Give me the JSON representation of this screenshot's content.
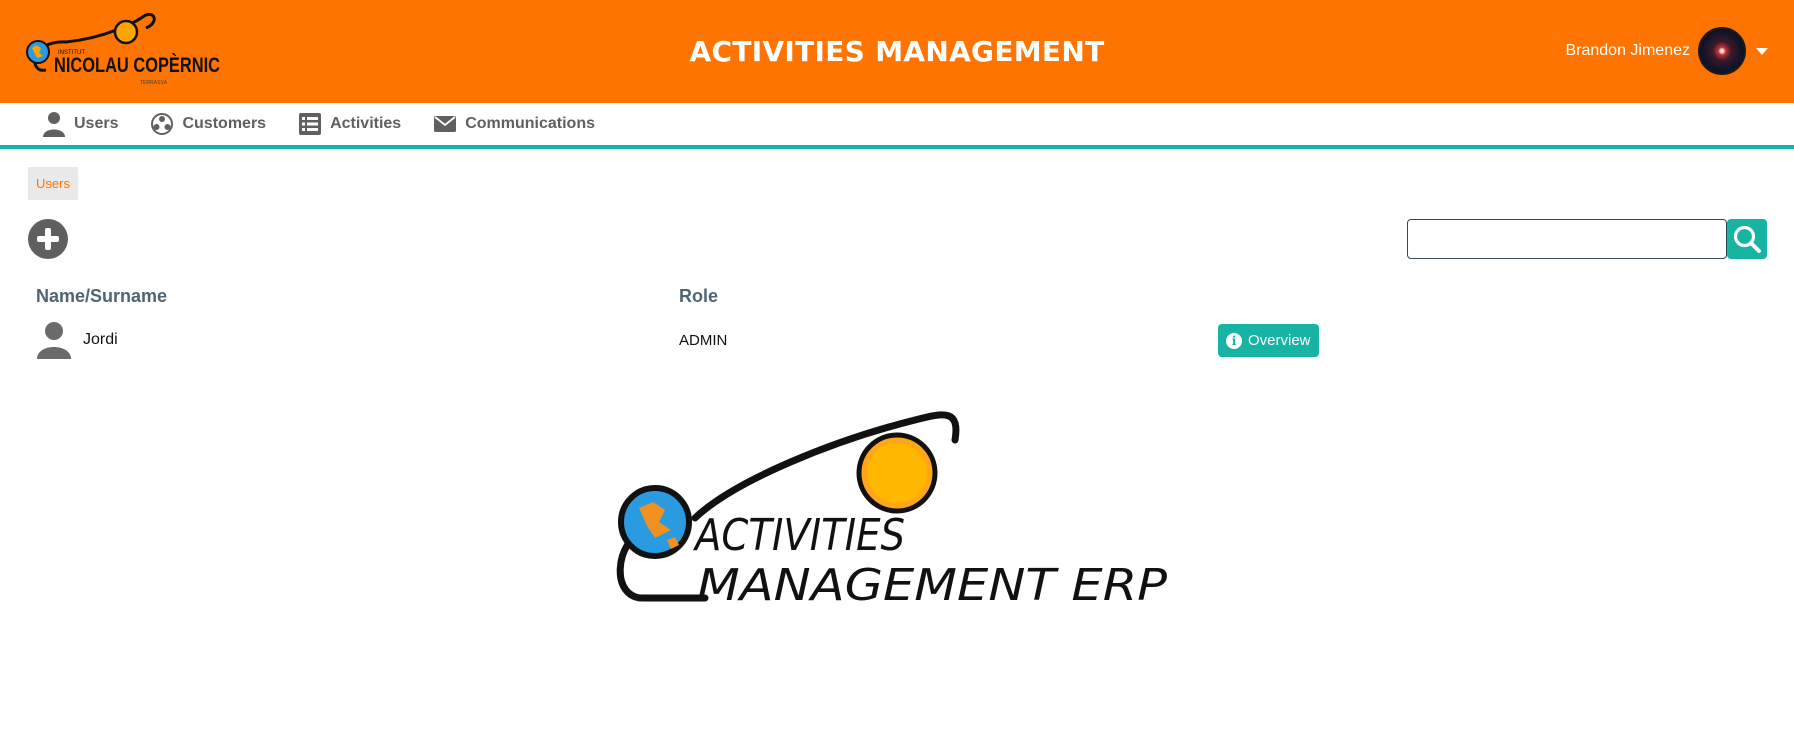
{
  "header": {
    "title": "ACTIVITIES MANAGEMENT",
    "logo": {
      "line1": "INSTITUT",
      "line2": "NICOLAU COPÈRNIC",
      "line3": "TERRASSA"
    },
    "user_name": "Brandon Jimenez",
    "background_color": "#ff7300"
  },
  "nav": {
    "items": [
      {
        "label": "Users",
        "icon": "user-icon"
      },
      {
        "label": "Customers",
        "icon": "customers-icon"
      },
      {
        "label": "Activities",
        "icon": "list-icon"
      },
      {
        "label": "Communications",
        "icon": "envelope-icon"
      }
    ],
    "accent_color": "#17b3a3"
  },
  "breadcrumb": {
    "current": "Users"
  },
  "search": {
    "value": "",
    "placeholder": ""
  },
  "table": {
    "columns": [
      "Name/Surname",
      "Role"
    ],
    "rows": [
      {
        "name": "Jordi",
        "role": "ADMIN",
        "action": "Overview"
      }
    ]
  },
  "footer_logo": {
    "line1": "ACTIVITIES",
    "line2": "MANAGEMENT ERP"
  }
}
